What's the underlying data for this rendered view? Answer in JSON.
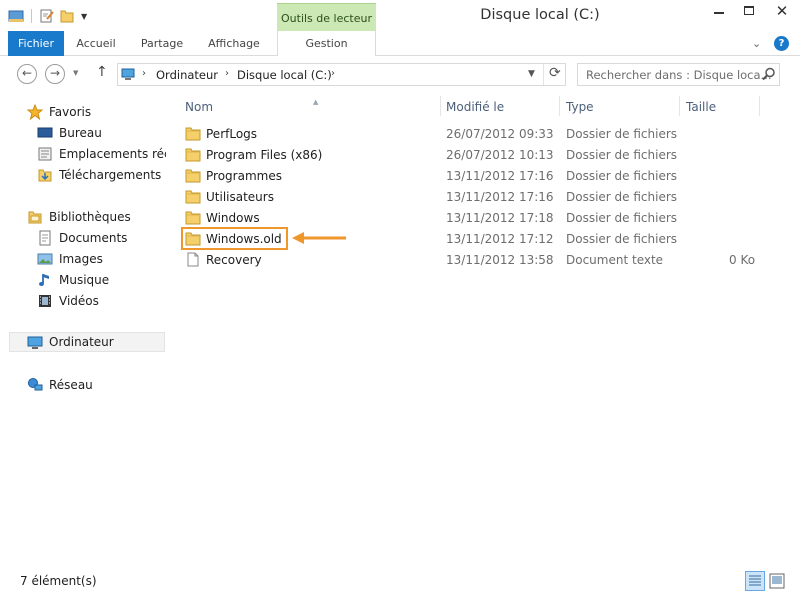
{
  "window": {
    "title": "Disque local (C:)",
    "close_glyph": "✕"
  },
  "ribbon": {
    "context_group": "Outils de lecteur",
    "tabs": {
      "file": "Fichier",
      "home": "Accueil",
      "share": "Partage",
      "view": "Affichage",
      "manage": "Gestion"
    },
    "help": "?"
  },
  "address": {
    "crumbs": [
      "Ordinateur",
      "Disque local (C:)"
    ],
    "search_placeholder": "Rechercher dans : Disque loca..."
  },
  "nav": {
    "favorites": {
      "label": "Favoris",
      "items": [
        "Bureau",
        "Emplacements récents",
        "Téléchargements"
      ]
    },
    "libraries": {
      "label": "Bibliothèques",
      "items": [
        "Documents",
        "Images",
        "Musique",
        "Vidéos"
      ]
    },
    "computer": "Ordinateur",
    "network": "Réseau"
  },
  "columns": {
    "name": "Nom",
    "modified": "Modifié le",
    "type": "Type",
    "size": "Taille"
  },
  "files": [
    {
      "name": "PerfLogs",
      "modified": "26/07/2012 09:33",
      "type": "Dossier de fichiers",
      "size": "",
      "icon": "folder-icon"
    },
    {
      "name": "Program Files (x86)",
      "modified": "26/07/2012 10:13",
      "type": "Dossier de fichiers",
      "size": "",
      "icon": "folder-icon"
    },
    {
      "name": "Programmes",
      "modified": "13/11/2012 17:16",
      "type": "Dossier de fichiers",
      "size": "",
      "icon": "folder-icon"
    },
    {
      "name": "Utilisateurs",
      "modified": "13/11/2012 17:16",
      "type": "Dossier de fichiers",
      "size": "",
      "icon": "folder-icon"
    },
    {
      "name": "Windows",
      "modified": "13/11/2012 17:18",
      "type": "Dossier de fichiers",
      "size": "",
      "icon": "folder-icon"
    },
    {
      "name": "Windows.old",
      "modified": "13/11/2012 17:12",
      "type": "Dossier de fichiers",
      "size": "",
      "icon": "folder-icon"
    },
    {
      "name": "Recovery",
      "modified": "13/11/2012 13:58",
      "type": "Document texte",
      "size": "0 Ko",
      "icon": "text-file-icon"
    }
  ],
  "highlight": {
    "target": "Windows.old",
    "color": "#f0972c"
  },
  "status": {
    "count": "7 élément(s)"
  },
  "colors": {
    "accent": "#1979ca",
    "context_tab": "#cce8b5",
    "header_text": "#4c607a"
  }
}
